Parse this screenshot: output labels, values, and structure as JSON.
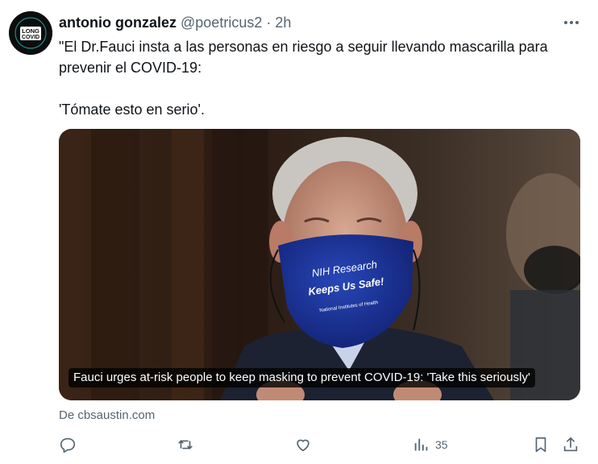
{
  "tweet": {
    "author_name": "antonio gonzalez",
    "handle": "@poetricus2",
    "separator": "·",
    "time": "2h",
    "avatar_text": "LONG COVID",
    "paragraphs": [
      "\"El Dr.Fauci insta a las personas en riesgo a seguir llevando mascarilla para prevenir el COVID-19:",
      "'Tómate esto en serio'."
    ]
  },
  "card": {
    "caption": "Fauci urges at-risk people to keep masking to prevent COVID-19: 'Take this seriously'",
    "mask_text_line1": "NIH Research",
    "mask_text_line2": "Keeps Us Safe!",
    "mask_text_line3": "National Institutes of Health",
    "source": "De cbsaustin.com"
  },
  "actions": {
    "reply_icon": "reply-icon",
    "retweet_icon": "retweet-icon",
    "like_icon": "heart-icon",
    "views_icon": "views-icon",
    "views_count": "35",
    "bookmark_icon": "bookmark-icon",
    "share_icon": "share-icon"
  },
  "colors": {
    "text_primary": "#0f1419",
    "text_secondary": "#536471",
    "mask_blue": "#1f3aa0"
  }
}
